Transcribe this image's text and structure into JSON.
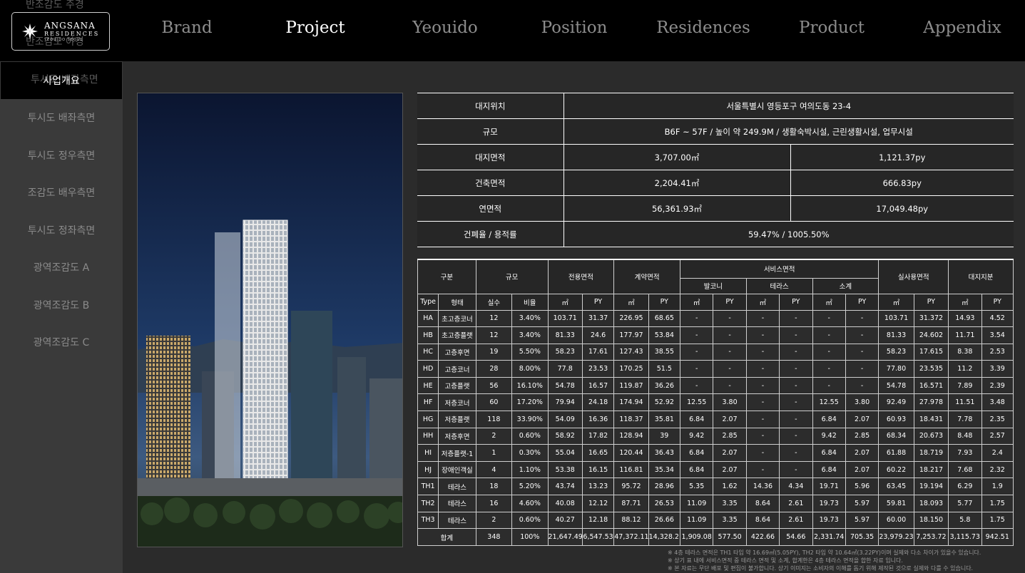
{
  "header": {
    "logo_name": "ANGSANA",
    "logo_sub": "RESIDENCES",
    "logo_loc": "YEOUIDO SEOUL",
    "ghost_top": "반조감도 주경",
    "ghost_mid": "반조감도 야경"
  },
  "nav": [
    "Brand",
    "Project",
    "Yeouido",
    "Position",
    "Residences",
    "Product",
    "Appendix"
  ],
  "nav_active": "Project",
  "sidebar": {
    "items": [
      "사업개요",
      "투시도 배좌측면",
      "투시도 정우측면",
      "조감도 배우측면",
      "투시도 정좌측면",
      "광역조감도 A",
      "광역조감도 B",
      "광역조감도 C"
    ],
    "ghost_under_active": "투시도 배좌측면"
  },
  "info": {
    "location_label": "대지위치",
    "location": "서울특별시 영등포구 여의도동 23-4",
    "scale_label": "규모",
    "scale": "B6F ~ 57F / 높이 약 249.9M / 생활숙박시설, 근린생활시설, 업무시설",
    "site_label": "대지면적",
    "site_m2": "3,707.00㎡",
    "site_py": "1,121.37py",
    "building_label": "건축면적",
    "building_m2": "2,204.41㎡",
    "building_py": "666.83py",
    "floor_label": "연면적",
    "floor_m2": "56,361.93㎡",
    "floor_py": "17,049.48py",
    "ratio_label": "건폐율 / 용적률",
    "ratio": "59.47% / 1005.50%"
  },
  "unit_table": {
    "h_gubun": "구분",
    "h_gyumo": "규모",
    "h_exclusive": "전용면적",
    "h_contract": "계약면적",
    "h_service": "서비스면적",
    "h_balcony": "발코니",
    "h_terrace": "테라스",
    "h_subtotal": "소계",
    "h_actual": "실사용면적",
    "h_land": "대지지분",
    "sub": [
      "Type",
      "형태",
      "실수",
      "비율",
      "㎡",
      "PY",
      "㎡",
      "PY",
      "㎡",
      "PY",
      "㎡",
      "PY",
      "㎡",
      "PY",
      "㎡",
      "PY",
      "㎡",
      "PY"
    ],
    "rows": [
      [
        "HA",
        "초고층코너",
        "12",
        "3.40%",
        "103.71",
        "31.37",
        "226.95",
        "68.65",
        "-",
        "-",
        "-",
        "-",
        "-",
        "-",
        "103.71",
        "31.372",
        "14.93",
        "4.52"
      ],
      [
        "HB",
        "초고층플랫",
        "12",
        "3.40%",
        "81.33",
        "24.6",
        "177.97",
        "53.84",
        "-",
        "-",
        "-",
        "-",
        "-",
        "-",
        "81.33",
        "24.602",
        "11.71",
        "3.54"
      ],
      [
        "HC",
        "고층후면",
        "19",
        "5.50%",
        "58.23",
        "17.61",
        "127.43",
        "38.55",
        "-",
        "-",
        "-",
        "-",
        "-",
        "-",
        "58.23",
        "17.615",
        "8.38",
        "2.53"
      ],
      [
        "HD",
        "고층코너",
        "28",
        "8.00%",
        "77.8",
        "23.53",
        "170.25",
        "51.5",
        "-",
        "-",
        "-",
        "-",
        "-",
        "-",
        "77.80",
        "23.535",
        "11.2",
        "3.39"
      ],
      [
        "HE",
        "고층플랫",
        "56",
        "16.10%",
        "54.78",
        "16.57",
        "119.87",
        "36.26",
        "-",
        "-",
        "-",
        "-",
        "-",
        "-",
        "54.78",
        "16.571",
        "7.89",
        "2.39"
      ],
      [
        "HF",
        "저층코너",
        "60",
        "17.20%",
        "79.94",
        "24.18",
        "174.94",
        "52.92",
        "12.55",
        "3.80",
        "-",
        "-",
        "12.55",
        "3.80",
        "92.49",
        "27.978",
        "11.51",
        "3.48"
      ],
      [
        "HG",
        "저층플랫",
        "118",
        "33.90%",
        "54.09",
        "16.36",
        "118.37",
        "35.81",
        "6.84",
        "2.07",
        "-",
        "-",
        "6.84",
        "2.07",
        "60.93",
        "18.431",
        "7.78",
        "2.35"
      ],
      [
        "HH",
        "저층후면",
        "2",
        "0.60%",
        "58.92",
        "17.82",
        "128.94",
        "39",
        "9.42",
        "2.85",
        "-",
        "-",
        "9.42",
        "2.85",
        "68.34",
        "20.673",
        "8.48",
        "2.57"
      ],
      [
        "HI",
        "저층플랫-1",
        "1",
        "0.30%",
        "55.04",
        "16.65",
        "120.44",
        "36.43",
        "6.84",
        "2.07",
        "-",
        "-",
        "6.84",
        "2.07",
        "61.88",
        "18.719",
        "7.93",
        "2.4"
      ],
      [
        "HJ",
        "장애인객실",
        "4",
        "1.10%",
        "53.38",
        "16.15",
        "116.81",
        "35.34",
        "6.84",
        "2.07",
        "-",
        "-",
        "6.84",
        "2.07",
        "60.22",
        "18.217",
        "7.68",
        "2.32"
      ],
      [
        "TH1",
        "테라스",
        "18",
        "5.20%",
        "43.74",
        "13.23",
        "95.72",
        "28.96",
        "5.35",
        "1.62",
        "14.36",
        "4.34",
        "19.71",
        "5.96",
        "63.45",
        "19.194",
        "6.29",
        "1.9"
      ],
      [
        "TH2",
        "테라스",
        "16",
        "4.60%",
        "40.08",
        "12.12",
        "87.71",
        "26.53",
        "11.09",
        "3.35",
        "8.64",
        "2.61",
        "19.73",
        "5.97",
        "59.81",
        "18.093",
        "5.77",
        "1.75"
      ],
      [
        "TH3",
        "테라스",
        "2",
        "0.60%",
        "40.27",
        "12.18",
        "88.12",
        "26.66",
        "11.09",
        "3.35",
        "8.64",
        "2.61",
        "19.73",
        "5.97",
        "60.00",
        "18.150",
        "5.8",
        "1.75"
      ]
    ],
    "total": [
      "합계",
      "348",
      "100%",
      "21,647.49",
      "6,547.53",
      "47,372.11",
      "14,328.21",
      "1,909.08",
      "577.50",
      "422.66",
      "54.66",
      "2,331.74",
      "705.35",
      "23,979.23",
      "7,253.72",
      "3,115.73",
      "942.51"
    ]
  },
  "notes": [
    "※ 4층 테라스 면적은 TH1 타입 약 16.69㎡(5.05PY), TH2 타입 약 10.64㎡(3.22PY)이며 실제와 다소 차이가 있을수 있습니다.",
    "※ 상기 표 내에 서비스면적 중 테라스 면적 및 소계, 합계한은 4층 테라스 면적을 합한 자료 입니다.",
    "※ 본 자료는 무단 배포 및 편집이 불가합니다. 상기 이미지는 소비자의 이해를 돕기 위해 제작된 것으로 실제와 다를 수 있습니다."
  ]
}
